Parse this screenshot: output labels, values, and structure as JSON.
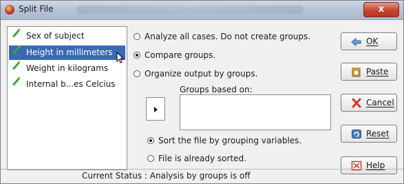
{
  "window": {
    "title": "Split File",
    "close_glyph": "x"
  },
  "variables": {
    "items": [
      {
        "label": "Sex of subject",
        "icon": "pencil-icon",
        "selected": false
      },
      {
        "label": "Height in millimeters",
        "icon": "pencil-icon",
        "selected": true
      },
      {
        "label": "Weight in kilograms",
        "icon": "pencil-icon",
        "selected": false
      },
      {
        "label": "Internal b...es Celcius",
        "icon": "pencil-icon",
        "selected": false
      }
    ]
  },
  "options": {
    "analyze_all": "Analyze all cases.  Do not create groups.",
    "compare_groups": "Compare groups.",
    "organize_output": "Organize output by groups.",
    "selected": "compare_groups"
  },
  "groups": {
    "label": "Groups based on:",
    "move_icon": "arrow-right-icon"
  },
  "sort": {
    "by_grouping": "Sort the file by grouping variables.",
    "already_sorted": "File is already sorted.",
    "selected": "by_grouping"
  },
  "buttons": {
    "ok": "OK",
    "paste": "Paste",
    "cancel": "Cancel",
    "reset": "Reset",
    "help": "Help"
  },
  "status": "Current Status : Analysis by groups is off",
  "colors": {
    "selection": "#3a6ab5",
    "titlebar": "#b7c4d8",
    "close": "#c9432d"
  }
}
